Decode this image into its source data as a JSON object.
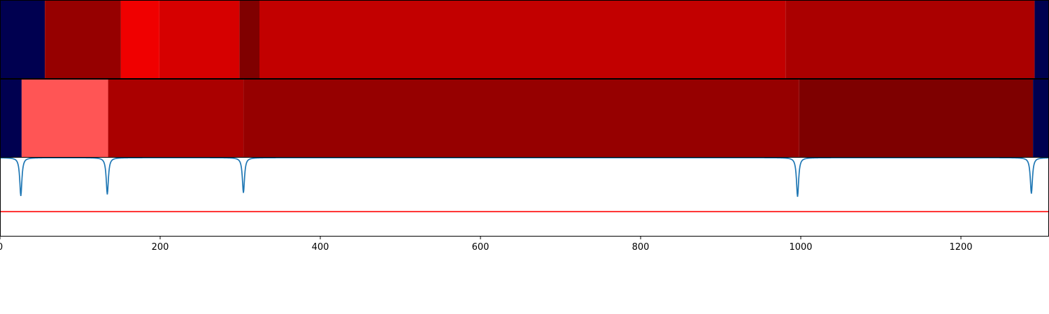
{
  "chart_data": [
    {
      "type": "heatmap",
      "x_range": [
        0,
        1310
      ],
      "segments": [
        {
          "start": 0,
          "end": 56,
          "color": "#000050"
        },
        {
          "start": 56,
          "end": 151,
          "color": "#960000"
        },
        {
          "start": 151,
          "end": 199,
          "color": "#f00000"
        },
        {
          "start": 199,
          "end": 299,
          "color": "#d60000"
        },
        {
          "start": 299,
          "end": 324,
          "color": "#800000"
        },
        {
          "start": 324,
          "end": 981,
          "color": "#c20000"
        },
        {
          "start": 981,
          "end": 1292,
          "color": "#aa0000"
        },
        {
          "start": 1292,
          "end": 1310,
          "color": "#000050"
        }
      ]
    },
    {
      "type": "heatmap",
      "x_range": [
        0,
        1310
      ],
      "segments": [
        {
          "start": 0,
          "end": 27,
          "color": "#000050"
        },
        {
          "start": 27,
          "end": 135,
          "color": "#ff5555"
        },
        {
          "start": 135,
          "end": 304,
          "color": "#aa0000"
        },
        {
          "start": 304,
          "end": 998,
          "color": "#960000"
        },
        {
          "start": 998,
          "end": 1290,
          "color": "#7e0000"
        },
        {
          "start": 1290,
          "end": 1310,
          "color": "#000050"
        }
      ]
    },
    {
      "type": "line",
      "xlim": [
        0,
        1310
      ],
      "ylim": [
        0,
        1
      ],
      "xticks": [
        "0",
        "200",
        "400",
        "600",
        "800",
        "1000",
        "1200"
      ],
      "xtick_values": [
        0,
        200,
        400,
        600,
        800,
        1000,
        1200
      ],
      "grid": false,
      "series": [
        {
          "type": "dips",
          "color": "#1f77b4",
          "baseline": 1.0,
          "dips": [
            {
              "x": 26,
              "y": 0.51
            },
            {
              "x": 134,
              "y": 0.53
            },
            {
              "x": 304,
              "y": 0.55
            },
            {
              "x": 996,
              "y": 0.5
            },
            {
              "x": 1288,
              "y": 0.54
            }
          ]
        },
        {
          "type": "hline",
          "color": "#ff0000",
          "y": 0.31
        }
      ]
    }
  ]
}
